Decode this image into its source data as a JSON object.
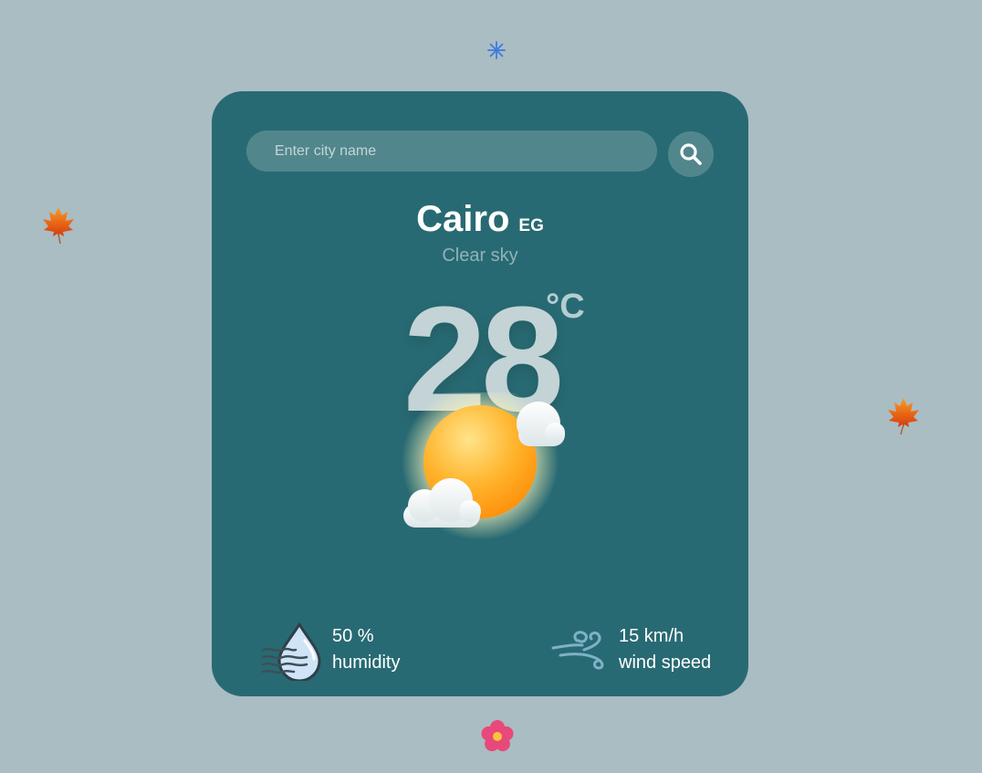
{
  "search": {
    "placeholder": "Enter city name",
    "icon": "search-icon"
  },
  "location": {
    "city": "Cairo",
    "country": "EG"
  },
  "weather": {
    "description": "Clear sky",
    "temperature": "28",
    "unit": "°C",
    "icon": "sun-with-clouds-icon"
  },
  "stats": {
    "humidity": {
      "value": "50 %",
      "label": "humidity",
      "icon": "humidity-drop-icon"
    },
    "wind": {
      "value": "15 km/h",
      "label": "wind speed",
      "icon": "wind-icon"
    }
  },
  "colors": {
    "background": "#a9bdc3",
    "card": "#286a73",
    "accent": "#52868d"
  }
}
